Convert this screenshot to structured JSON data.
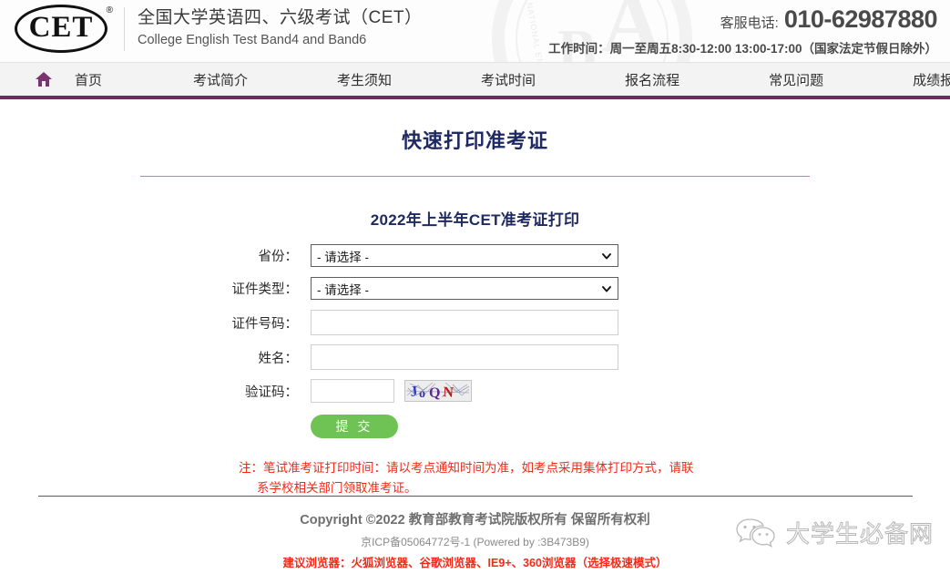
{
  "header": {
    "logo_text": "CET",
    "logo_reg": "®",
    "title_cn": "全国大学英语四、六级考试（CET）",
    "title_en": "College English Test Band4 and Band6",
    "contact_label": "客服电话:",
    "contact_phone": "010-62987880",
    "hours_label": "工作时间：",
    "hours_value": "周一至周五8:30-12:00 13:00-17:00（国家法定节假日除外）"
  },
  "nav": {
    "home_icon": "home-icon",
    "items": [
      {
        "label": "首页"
      },
      {
        "label": "考试简介"
      },
      {
        "label": "考生须知"
      },
      {
        "label": "考试时间"
      },
      {
        "label": "报名流程"
      },
      {
        "label": "常见问题"
      },
      {
        "label": "成绩报告单"
      }
    ]
  },
  "main": {
    "page_title": "快速打印准考证",
    "form_subtitle": "2022年上半年CET准考证打印",
    "fields": {
      "province_label": "省份：",
      "province_value": "- 请选择 -",
      "idtype_label": "证件类型：",
      "idtype_value": "- 请选择 -",
      "idnumber_label": "证件号码：",
      "idnumber_value": "",
      "idnumber_placeholder": "",
      "name_label": "姓名：",
      "name_value": "",
      "name_placeholder": "",
      "captcha_label": "验证码：",
      "captcha_value": "",
      "captcha_placeholder": "",
      "captcha_image_text": "JoQN"
    },
    "submit_label": "提 交",
    "note_line1": "注：笔试准考证打印时间：请以考点通知时间为准，如考点采用集体打印方式，请联",
    "note_line2": "系学校相关部门领取准考证。"
  },
  "footer": {
    "copyright": "Copyright ©2022 教育部教育考试院版权所有 保留所有权利",
    "icp": "京ICP备05064772号-1 (Powered by :3B473B9)",
    "browsers": "建议浏览器：火狐浏览器、谷歌浏览器、IE9+、360浏览器（选择极速模式）",
    "watermark_text": "大学生必备网",
    "watermark_icon": "wechat-icon"
  },
  "colors": {
    "nav_underline": "#6e2a5e",
    "title": "#1f2a63",
    "title_rule": "#c97bb0",
    "submit_green": "#6fc355",
    "note_red": "#f42a18"
  }
}
